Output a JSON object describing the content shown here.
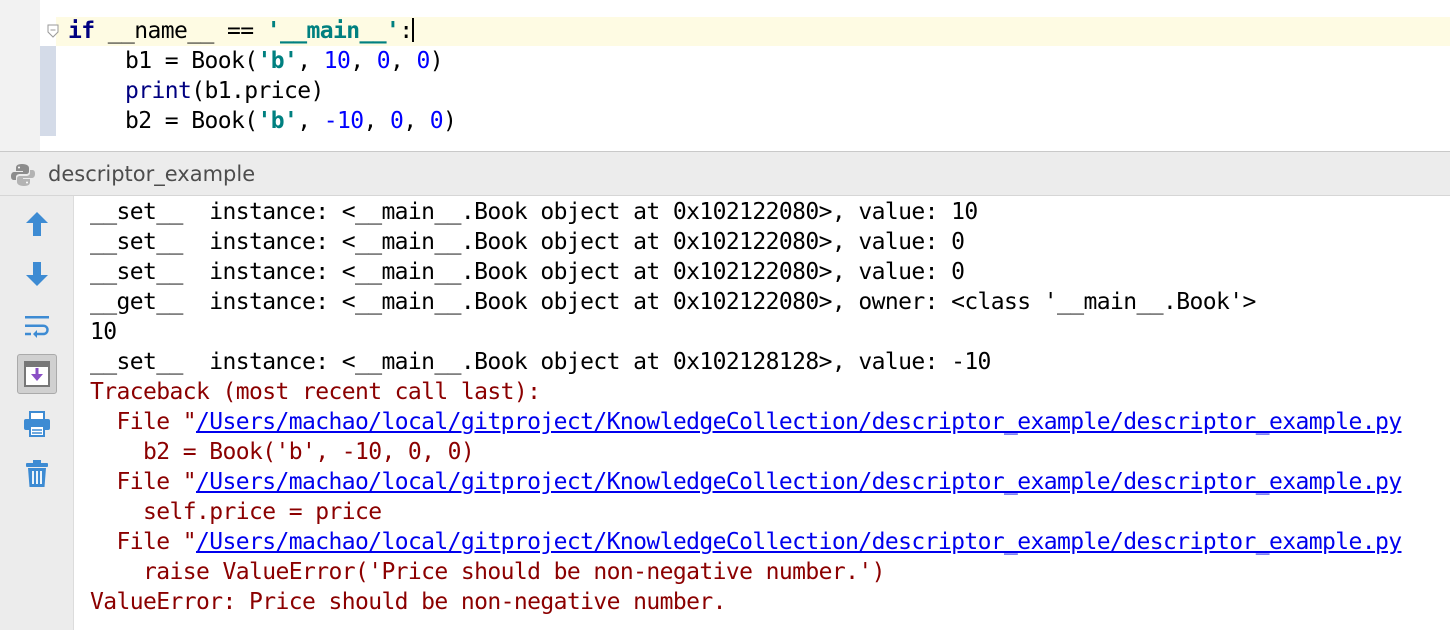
{
  "editor": {
    "lines": {
      "l1": {
        "kw": "if",
        "mid": " __name__ == ",
        "str": "'__main__'",
        "end": ":"
      },
      "l2": {
        "a": "b1 = Book(",
        "s": "'b'",
        "c1": ", ",
        "n1": "10",
        "c2": ", ",
        "n2": "0",
        "c3": ", ",
        "n3": "0",
        "e": ")"
      },
      "l3": {
        "fn": "print",
        "rest": "(b1.price)"
      },
      "l4": {
        "a": "b2 = Book(",
        "s": "'b'",
        "c1": ", ",
        "n1": "-10",
        "c2": ", ",
        "n2": "0",
        "c3": ", ",
        "n3": "0",
        "e": ")"
      }
    }
  },
  "run_panel": {
    "title": "descriptor_example",
    "toolbar": [
      "arrow-up-icon",
      "arrow-down-icon",
      "soft-wrap-icon",
      "scroll-to-end-icon",
      "print-icon",
      "trash-icon"
    ],
    "output": {
      "o1": "__set__  instance: <__main__.Book object at 0x102122080>, value: 10",
      "o2": "__set__  instance: <__main__.Book object at 0x102122080>, value: 0",
      "o3": "__set__  instance: <__main__.Book object at 0x102122080>, value: 0",
      "o4": "__get__  instance: <__main__.Book object at 0x102122080>, owner: <class '__main__.Book'>",
      "o5": "10",
      "o6": "__set__  instance: <__main__.Book object at 0x102128128>, value: -10"
    },
    "traceback": {
      "header": "Traceback (most recent call last):",
      "file_prefix": "  File \"",
      "path": "/Users/machao/local/gitproject/KnowledgeCollection/descriptor_example/descriptor_example.py",
      "f1_code": "    b2 = Book('b', -10, 0, 0)",
      "f2_code": "    self.price = price",
      "f3_code": "    raise ValueError('Price should be non-negative number.')",
      "error": "ValueError: Price should be non-negative number."
    }
  },
  "colors": {
    "keyword": "#000080",
    "string": "#008080",
    "number": "#0000ff",
    "error_text": "#8b0000",
    "link": "#0000ee",
    "current_line": "#fefbe3"
  }
}
